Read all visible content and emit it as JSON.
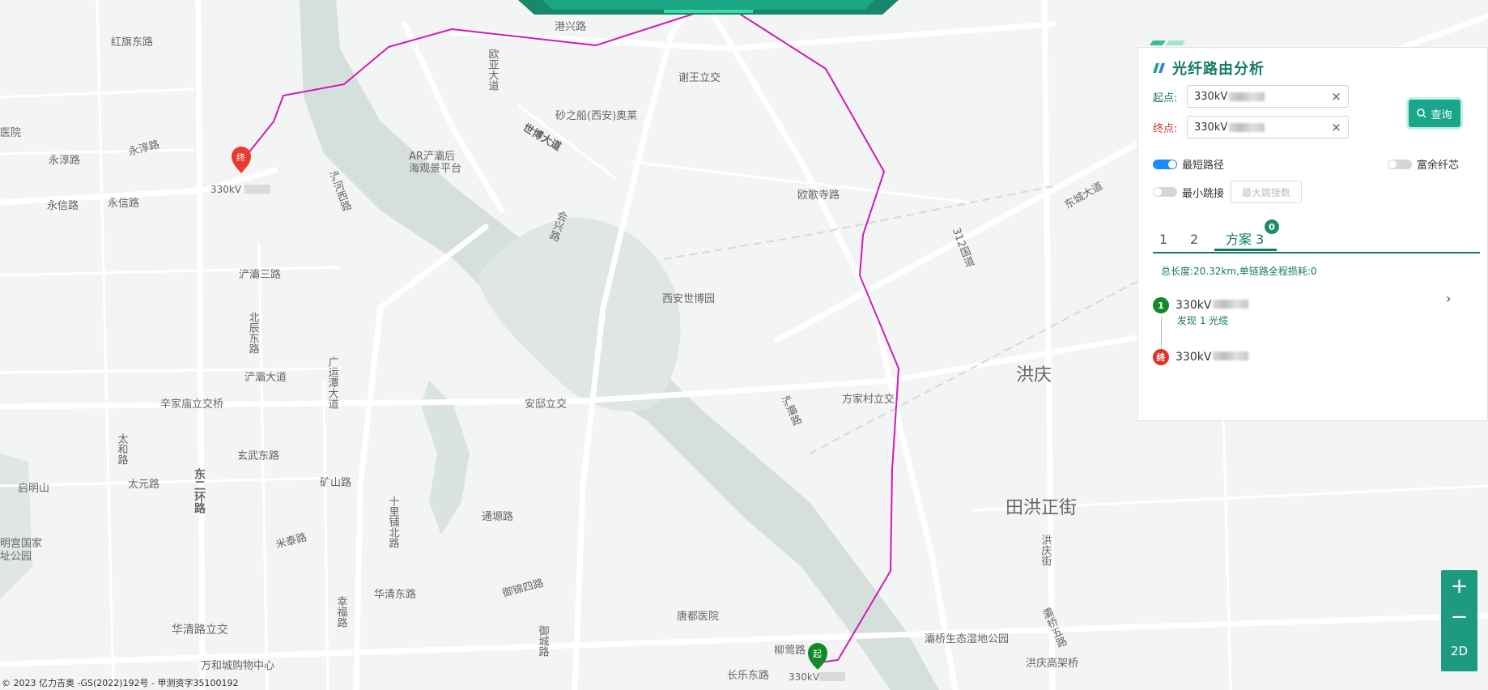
{
  "map": {
    "labels": {
      "hongqi_east": "红旗东路",
      "gangxing": "港兴路",
      "ouya": "欧亚大道",
      "xiewang": "谢王立交",
      "shazhichuan": "砂之船(西安)奥莱",
      "shibo": "世博大道",
      "ar_platform_1": "AR浐灞后",
      "ar_platform_2": "海观景平台",
      "yongchun_1": "永淳路",
      "yongchun_2": "永淳路",
      "yongxin_1": "永信路",
      "yongxin_2": "永信路",
      "hospital": "医院",
      "jinghe_west": "灞河西路",
      "xingtai": "兴泰南路",
      "chanhe_west": "浐河西路",
      "chanba3": "浐灞三路",
      "beichen": "北辰东路",
      "chanba_avenue": "浐灞大道",
      "guangyun": "广运潭大道",
      "xinjia": "辛家庙立交桥",
      "anqiu": "安邸立交",
      "expo_park": "西安世博园",
      "jinmao": "金茂一路",
      "huixing": "会兴路",
      "ougeng": "欧歌寺路",
      "g312": "312国道",
      "dongcheng": "东城大道",
      "hongqing": "洪庆",
      "fangjiacun": "方家村立交",
      "chanba_road": "浐灞路",
      "tianhong": "田洪正街",
      "hongqing_st": "洪庆街",
      "xuanwu": "玄武东路",
      "kuangshan": "矿山路",
      "taihe": "太和路",
      "taiyuan": "太元路",
      "qiming": "启明山",
      "east2ring": "东二环路",
      "shilipu": "十里铺北路",
      "tongta": "通塬路",
      "mitai": "米泰路",
      "damingpalace_1": "明宫国家",
      "damingpalace_2": "址公园",
      "huaqing_east": "华清东路",
      "yujin4": "御锦四路",
      "xingfu": "幸福路",
      "yucheng": "御城路",
      "huaqing_overpass": "华清路立交",
      "tangdu": "唐都医院",
      "liuying": "柳莺路",
      "changle_east": "长乐东路",
      "wanhe": "万和城购物中心",
      "wetland": "灞桥生态湿地公园",
      "hongqing_overpass": "洪庆高架桥",
      "baqiao5": "灞桥五路",
      "xiangwang": "香王路",
      "wangjia": "王家路",
      "station": "站",
      "north": "北路",
      "route_end_label": "330kV",
      "route_start_label": "330kV",
      "end_marker": "终",
      "start_marker": "起"
    },
    "route_color": "#d11ab6",
    "copyright": "© 2023 亿力吉奥 -GS(2022)192号 - 甲测资字35100192"
  },
  "panel": {
    "title": "光纤路由分析",
    "start_label": "起点:",
    "start_value": "330kV",
    "end_label": "终点:",
    "end_value": "330kV",
    "query_button": "查询",
    "shortest_path": "最短路径",
    "shortest_path_on": true,
    "redundant_core": "富余纤芯",
    "redundant_core_on": false,
    "min_hop": "最小跳接",
    "min_hop_on": false,
    "max_hop_placeholder": "最大跳接数",
    "tabs": [
      "1",
      "2",
      "方案 3"
    ],
    "active_tab": 2,
    "badge": "0",
    "summary": "总长度:20.32km,单链路全程损耗:0",
    "nodes": [
      {
        "marker": "1",
        "name": "330kV",
        "color": "#138a2a"
      },
      {
        "marker": "终",
        "name": "330kV",
        "color": "#e0322c"
      }
    ],
    "found_text": "发现 1 光缆"
  },
  "zoom": {
    "plus": "+",
    "minus": "−",
    "mode": "2D"
  },
  "colors": {
    "accent": "#137a63",
    "button": "#1aa68a",
    "route": "#d11ab6"
  }
}
